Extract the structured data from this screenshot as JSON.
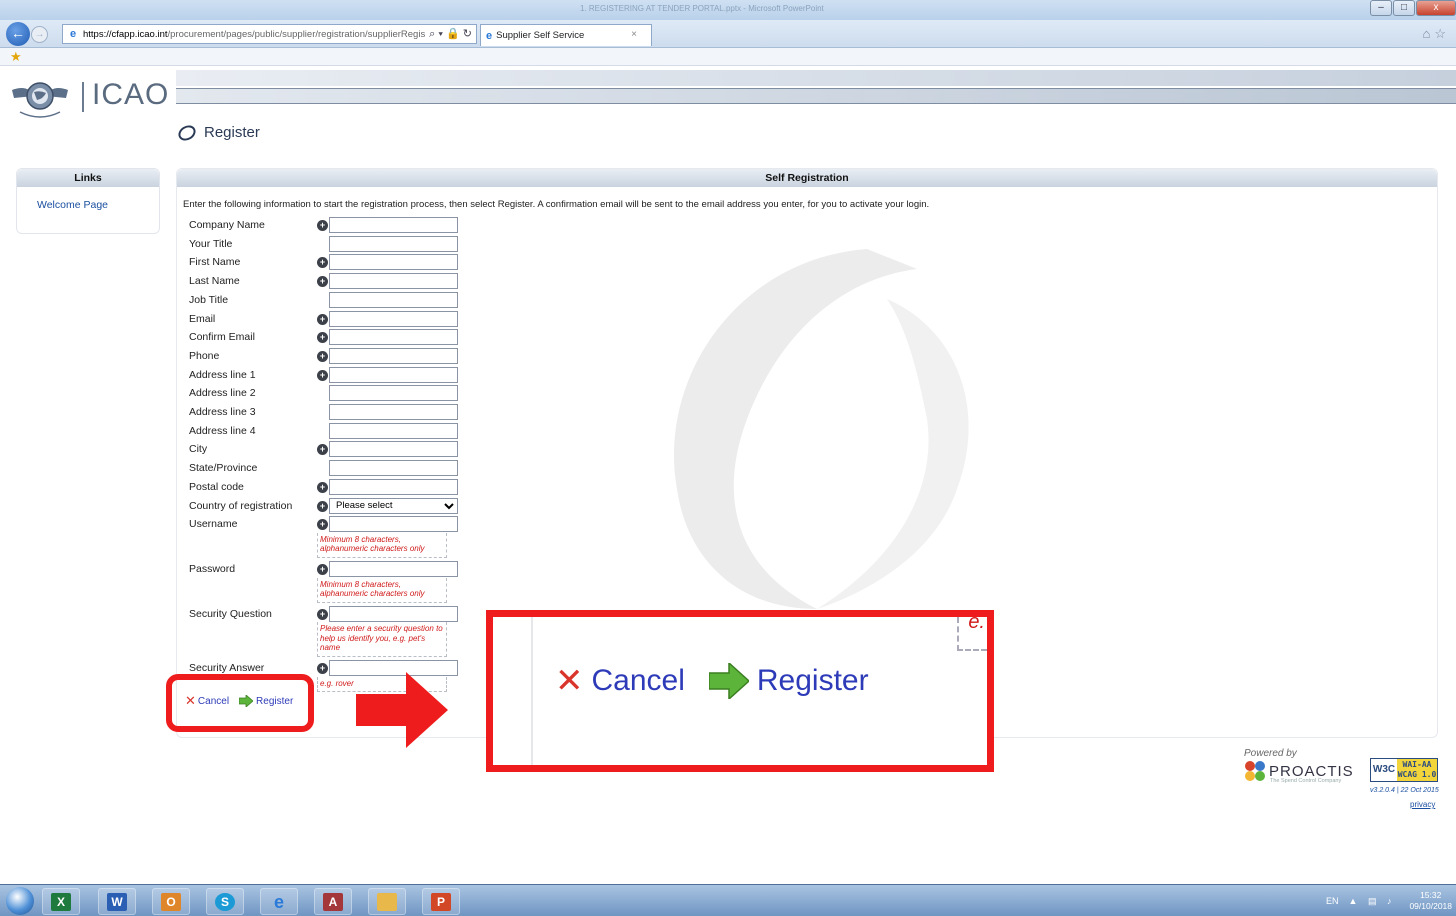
{
  "browser": {
    "window_title": "1. REGISTERING AT TENDER PORTAL.pptx - Microsoft PowerPoint",
    "address_host": "https://cfapp.icao.int",
    "address_path": "/procurement/pages/public/supplier/registration/supplierRegis",
    "address_tools": "⌕ ▾ 🔒 ↻",
    "tab_title": "Supplier Self Service",
    "tab_close": "×",
    "win_controls": [
      "–",
      "□",
      "x"
    ]
  },
  "header": {
    "logo_text": "ICAO",
    "page_heading": "Register"
  },
  "links_panel": {
    "title": "Links",
    "items": [
      "Welcome Page"
    ]
  },
  "registration": {
    "title": "Self Registration",
    "intro": "Enter the following information to start the registration process, then select Register. A confirmation email will be sent to the email address you enter, for you to activate your login.",
    "fields": [
      {
        "label": "Company Name",
        "required": true,
        "value": ""
      },
      {
        "label": "Your Title",
        "required": false,
        "value": ""
      },
      {
        "label": "First Name",
        "required": true,
        "value": ""
      },
      {
        "label": "Last Name",
        "required": true,
        "value": ""
      },
      {
        "label": "Job Title",
        "required": false,
        "value": ""
      },
      {
        "label": "Email",
        "required": true,
        "value": ""
      },
      {
        "label": "Confirm Email",
        "required": true,
        "value": ""
      },
      {
        "label": "Phone",
        "required": true,
        "value": ""
      },
      {
        "label": "Address line 1",
        "required": true,
        "value": ""
      },
      {
        "label": "Address line 2",
        "required": false,
        "value": ""
      },
      {
        "label": "Address line 3",
        "required": false,
        "value": ""
      },
      {
        "label": "Address line 4",
        "required": false,
        "value": ""
      },
      {
        "label": "City",
        "required": true,
        "value": ""
      },
      {
        "label": "State/Province",
        "required": false,
        "value": ""
      },
      {
        "label": "Postal code",
        "required": true,
        "value": ""
      },
      {
        "label": "Country of registration",
        "required": true,
        "value": "Please select",
        "type": "select"
      },
      {
        "label": "Username",
        "required": true,
        "value": "",
        "hint": "Minimum 8 characters, alphanumeric characters only"
      },
      {
        "label": "Password",
        "required": true,
        "value": "",
        "hint": "Minimum 8 characters, alphanumeric characters only"
      },
      {
        "label": "Security Question",
        "required": true,
        "value": "",
        "hint": "Please enter a security question to help us identify you, e.g. pet's name"
      },
      {
        "label": "Security Answer",
        "required": true,
        "value": "",
        "hint": "e.g. rover"
      }
    ],
    "cancel_label": "Cancel",
    "register_label": "Register"
  },
  "zoom_callout": {
    "cancel_label": "Cancel",
    "register_label": "Register",
    "partial_hint_letter": "e.",
    "highlight_color": "#ee1c1c"
  },
  "footer": {
    "powered_by": "Powered by",
    "vendor": "PROACTIS",
    "vendor_tagline": "The Spend Control Company",
    "w3c_label": "W3C",
    "wcag_badge": "WAI-AA WCAG 1.0",
    "version": "v3.2.0.4 | 22 Oct 2015",
    "privacy": "privacy"
  },
  "taskbar": {
    "apps": [
      "Internet Explorer",
      "Excel",
      "Word",
      "Outlook",
      "Skype",
      "Internet Explorer",
      "Access",
      "File Explorer",
      "PowerPoint"
    ],
    "language": "EN",
    "time": "15:32",
    "date": "09/10/2018"
  },
  "colors": {
    "link_blue": "#1a4fa0",
    "action_blue": "#2e3bb8",
    "hint_red": "#d01a1a",
    "annotation_red": "#ee1c1c"
  }
}
